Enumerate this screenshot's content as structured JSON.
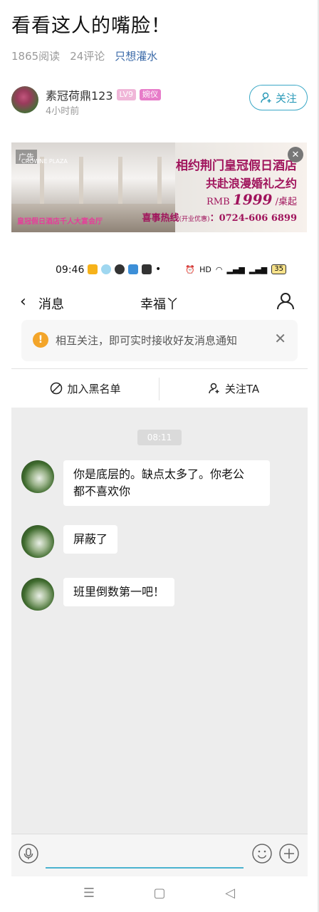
{
  "post": {
    "title": "看看这人的嘴脸！",
    "reads": "1865阅读",
    "comments": "24评论",
    "only_water": "只想灌水",
    "author": {
      "name": "素冠荷鼎123",
      "level": "LV9",
      "title_badge": "婉仪",
      "time": "4小时前",
      "follow_label": "关注"
    }
  },
  "ad": {
    "tag": "广告",
    "logo": "CROWNE PLAZA",
    "line1": "相约荆门皇冠假日酒店",
    "line2": "共赴浪漫婚礼之约",
    "price_prefix": "RMB",
    "price": "1999",
    "price_suffix": "/桌起",
    "hotline_label": "喜事热线",
    "hotline_note": "(开业优惠)",
    "hotline_number": "：0724-606 6899",
    "caption": "皇冠假日酒店千人大宴会厅",
    "close": "✕"
  },
  "screenshot": {
    "status_time": "09:46",
    "battery": "35",
    "back_label": "消息",
    "chat_title": "幸福丫",
    "notice": "相互关注，即可实时接收好友消息通知",
    "blacklist_label": "加入黑名单",
    "follow_ta_label": "关注TA",
    "timestamp": "08:11",
    "messages": [
      {
        "text_line1": "你是底层的。缺点太多了。你老公",
        "text_line2": "都不喜欢你"
      },
      {
        "text_line1": "屏蔽了"
      },
      {
        "text_line1": "班里倒数第一吧！"
      }
    ]
  },
  "colors": {
    "accent": "#2a9ab8",
    "link": "#3b6aa8",
    "ad_text": "#a0145c",
    "notice_icon": "#f3a52a"
  }
}
